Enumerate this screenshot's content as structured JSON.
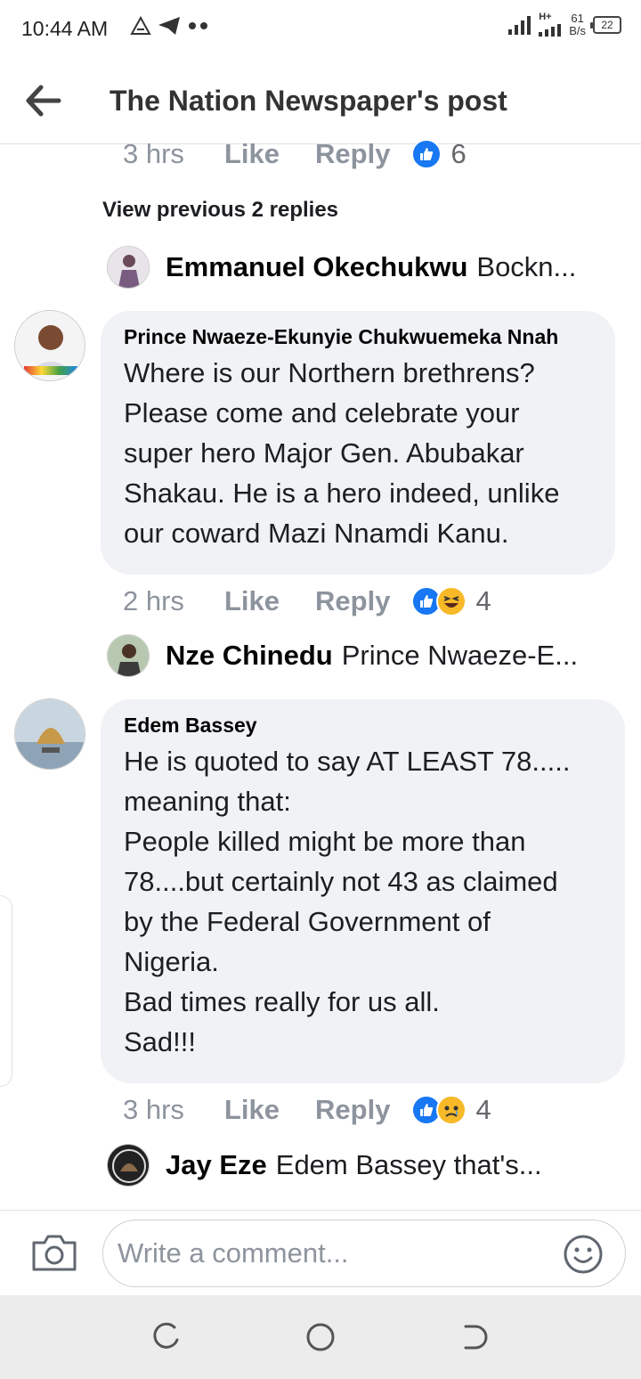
{
  "status_bar": {
    "time": "10:44 AM",
    "network_speed_value": "61",
    "network_speed_unit": "B/s",
    "network_type": "H+",
    "battery": "22"
  },
  "header": {
    "title": "The Nation Newspaper's post"
  },
  "top_meta": {
    "time": "3 hrs",
    "like": "Like",
    "reply": "Reply",
    "reaction_count": "6"
  },
  "view_previous": "View previous 2 replies",
  "reply_1": {
    "name": "Emmanuel Okechukwu",
    "text": "Bockn..."
  },
  "comment_1": {
    "author": "Prince Nwaeze-Ekunyie Chukwuemeka Nnah",
    "body": "Where is our Northern brethrens?\nPlease come and celebrate your\nsuper hero Major Gen. Abubakar\nShakau. He is a hero indeed, unlike\nour coward Mazi Nnamdi Kanu.",
    "time": "2 hrs",
    "like": "Like",
    "reply": "Reply",
    "reaction_count": "4"
  },
  "reply_2": {
    "name": "Nze Chinedu",
    "text": "Prince Nwaeze-E..."
  },
  "comment_2": {
    "author": "Edem Bassey",
    "body": "He is quoted to say AT LEAST 78.....\nmeaning that:\n People killed might be more than\n78....but certainly not 43 as claimed\nby the Federal Government of\nNigeria.\nBad times really for us all.\nSad!!!",
    "time": "3 hrs",
    "like": "Like",
    "reply": "Reply",
    "reaction_count": "4"
  },
  "reply_3": {
    "name": "Jay Eze",
    "text": "Edem Bassey that's..."
  },
  "composer": {
    "placeholder": "Write a comment..."
  },
  "colors": {
    "like_blue": "#1877f2",
    "bubble_bg": "#f0f2f5",
    "meta_gray": "#8d949e",
    "emoji_yellow": "#f7b928"
  }
}
